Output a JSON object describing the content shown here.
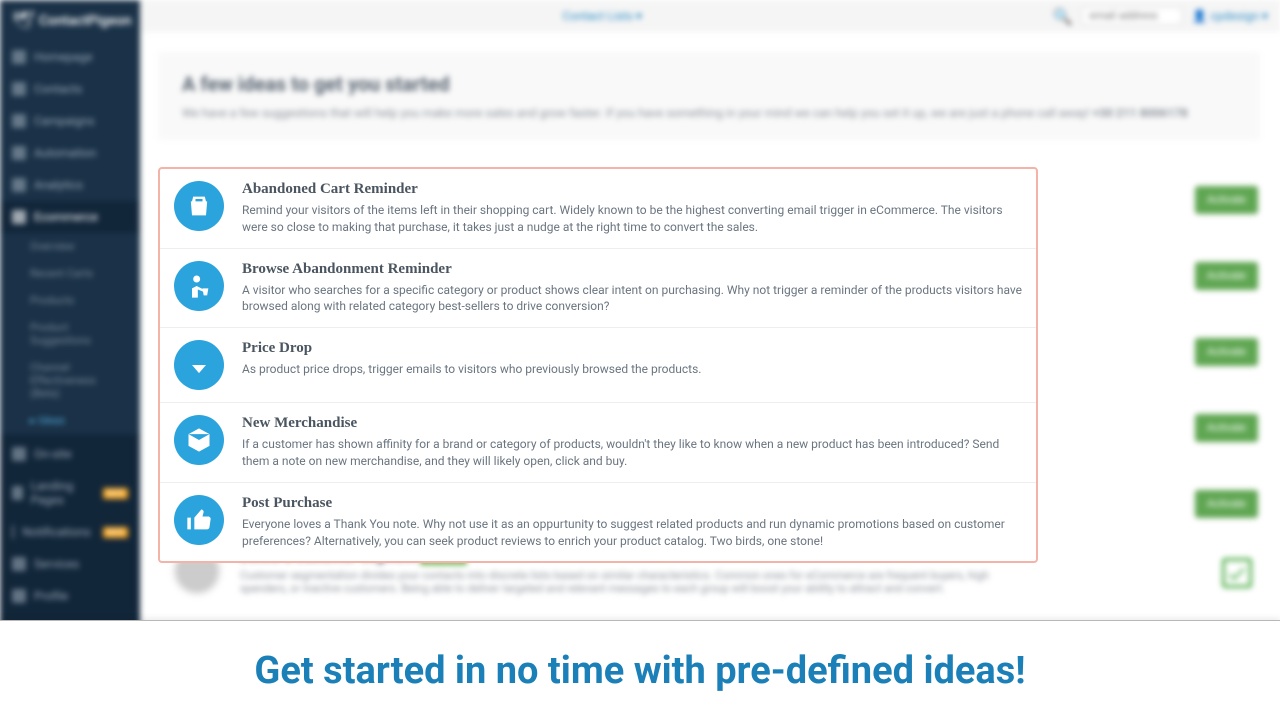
{
  "topbar": {
    "center_link": "Contact Lists ▾",
    "search_placeholder": "email address",
    "user_text": "cpdesign ▾"
  },
  "logo": {
    "text": "ContactPigeon"
  },
  "sidebar": {
    "items": [
      {
        "label": "Homepage"
      },
      {
        "label": "Contacts"
      },
      {
        "label": "Campaigns"
      },
      {
        "label": "Automation"
      },
      {
        "label": "Analytics"
      },
      {
        "label": "Ecommerce"
      }
    ],
    "sub": [
      {
        "label": "Overview"
      },
      {
        "label": "Recent Carts"
      },
      {
        "label": "Products"
      },
      {
        "label": "Product Suggestions"
      },
      {
        "label": "Channel Effectiveness (Beta)"
      },
      {
        "label": "Ideas"
      }
    ],
    "lower": [
      {
        "label": "On-site"
      },
      {
        "label": "Landing Pages",
        "badge": "NEW"
      },
      {
        "label": "Notifications",
        "badge": "NEW"
      },
      {
        "label": "Services"
      },
      {
        "label": "Profile"
      }
    ]
  },
  "header": {
    "title": "A few ideas to get you started",
    "sub": "We have a few suggestions that will help you make more sales and grow faster. If you have something in your mind we can help you set it up, we are just a phone call away!",
    "sub_b": "+30 211 8006178"
  },
  "ideas": [
    {
      "title": "Abandoned Cart Reminder",
      "desc": "Remind your visitors of the items left in their shopping cart. Widely known to be the highest converting email trigger in eCommerce. The visitors were so close to making that purchase, it takes just a nudge at the right time to convert the sales.",
      "icon": "bag-icon"
    },
    {
      "title": "Browse Abandonment Reminder",
      "desc": "A visitor who searches for a specific category or product shows clear intent on purchasing. Why not trigger a reminder of the products visitors have browsed along with related category best-sellers to drive conversion?",
      "icon": "person-cart-icon"
    },
    {
      "title": "Price Drop",
      "desc": "As product price drops, trigger emails to visitors who previously browsed the products.",
      "icon": "arrow-down-icon"
    },
    {
      "title": "New Merchandise",
      "desc": "If a customer has shown affinity for a brand or category of products, wouldn't they like to know when a new product has been introduced? Send them a note on new merchandise, and they will likely open, click and buy.",
      "icon": "box-icon"
    },
    {
      "title": "Post Purchase",
      "desc": "Everyone loves a Thank You note. Why not use it as an oppurtunity to suggest related products and run dynamic promotions based on customer preferences? Alternatively, you can seek product reviews to enrich your product catalog. Two birds, one stone!",
      "icon": "thumb-icon"
    }
  ],
  "extra": {
    "title": "Define a Customer Segment",
    "badge": "activated",
    "desc": "Customer segmentation divides your contacts into discrete lists based on similar characteristics. Common ones for eCommerce are frequent buyers, high spenders, or inactive customers. Being able to deliver targeted and relevant messages to each group will boost your ability to attract and convert."
  },
  "activate_label": "Activate",
  "banner": {
    "text": "Get started in no time with pre-defined ideas!"
  }
}
